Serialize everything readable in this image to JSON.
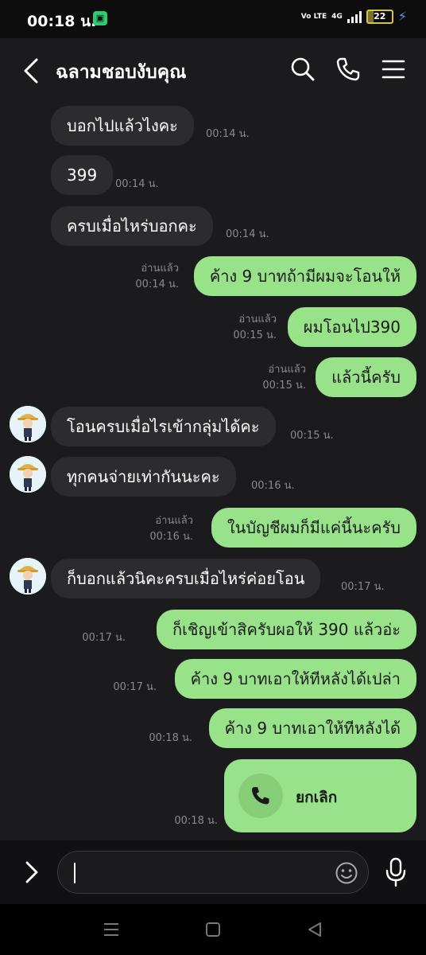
{
  "status_bar": {
    "time": "00:18 น.",
    "network_label": "4G",
    "volte_label": "Vo LTE",
    "battery": "22",
    "battery_color": "#d4c645",
    "charging_color": "#3fa0ff"
  },
  "header": {
    "title": "ฉลามชอบงับคุณ",
    "icons": [
      "back-icon",
      "search-icon",
      "phone-icon",
      "menu-icon"
    ]
  },
  "messages": [
    {
      "side": "received",
      "text": "บอกไปแล้วไงคะ",
      "time": "00:14 น."
    },
    {
      "side": "received",
      "text": "399",
      "time": "00:14 น."
    },
    {
      "side": "received",
      "text": "ครบเมื่อไหร่บอกคะ",
      "time": "00:14 น."
    },
    {
      "side": "sent",
      "text": "ค้าง 9 บาทถ้ามีผมจะโอนให้",
      "read": "อ่านแล้ว",
      "time": "00:14 น."
    },
    {
      "side": "sent",
      "text": "ผมโอนไป390",
      "read": "อ่านแล้ว",
      "time": "00:15 น."
    },
    {
      "side": "sent",
      "text": "แล้วนี้ครับ",
      "read": "อ่านแล้ว",
      "time": "00:15 น."
    },
    {
      "side": "received",
      "text": "โอนครบเมื่อไรเข้ากลุ่มได้คะ",
      "time": "00:15 น.",
      "avatar": true
    },
    {
      "side": "received",
      "text": "ทุกคนจ่ายเท่ากันนะคะ",
      "time": "00:16 น.",
      "avatar": true
    },
    {
      "side": "sent",
      "text": "ในบัญชีผมก็มีแค่นี้นะครับ",
      "read": "อ่านแล้ว",
      "time": "00:16 น."
    },
    {
      "side": "received",
      "text": "ก็บอกแล้วนิคะครบเมื่อไหร่ค่อยโอน",
      "time": "00:17 น.",
      "avatar": true
    },
    {
      "side": "sent",
      "text": "ก็เชิญเข้าสิครับผอให้ 390 แล้วอ่ะ",
      "time": "00:17 น."
    },
    {
      "side": "sent",
      "text": "ค้าง 9 บาทเอาให้ทีหลังได้เปล่า",
      "time": "00:17 น."
    },
    {
      "side": "sent",
      "text": "ค้าง 9 บาทเอาให้ทีหลังได้",
      "time": "00:18 น."
    }
  ],
  "call_message": {
    "label": "ยกเลิก",
    "time": "00:18 น.",
    "icon": "phone-icon"
  },
  "composer": {
    "placeholder": "",
    "icons": [
      "chevron-right-icon",
      "emoji-icon",
      "microphone-icon"
    ]
  },
  "colors": {
    "sent_bubble": "#98e28a",
    "received_bubble": "#2c2c2e",
    "background": "#1b1b1d"
  }
}
